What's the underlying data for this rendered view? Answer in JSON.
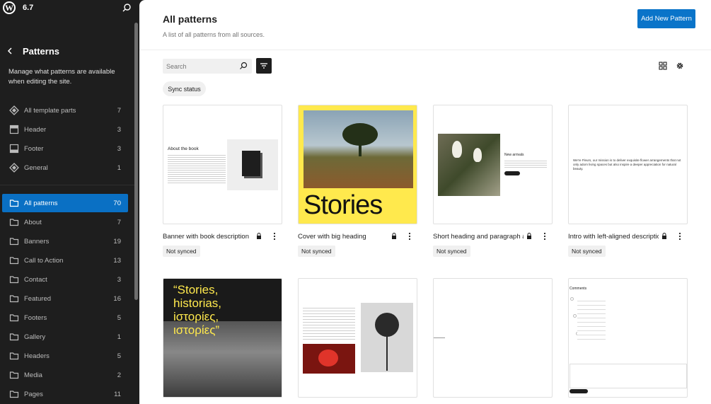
{
  "sidebar": {
    "version": "6.7",
    "title": "Patterns",
    "description": "Manage what patterns are available when editing the site.",
    "parts": [
      {
        "label": "All template parts",
        "count": "7",
        "icon": "diamond-icon"
      },
      {
        "label": "Header",
        "count": "3",
        "icon": "header-icon"
      },
      {
        "label": "Footer",
        "count": "3",
        "icon": "footer-icon"
      },
      {
        "label": "General",
        "count": "1",
        "icon": "diamond-icon"
      }
    ],
    "categories": [
      {
        "label": "All patterns",
        "count": "70"
      },
      {
        "label": "About",
        "count": "7"
      },
      {
        "label": "Banners",
        "count": "19"
      },
      {
        "label": "Call to Action",
        "count": "13"
      },
      {
        "label": "Contact",
        "count": "3"
      },
      {
        "label": "Featured",
        "count": "16"
      },
      {
        "label": "Footers",
        "count": "5"
      },
      {
        "label": "Gallery",
        "count": "1"
      },
      {
        "label": "Headers",
        "count": "5"
      },
      {
        "label": "Media",
        "count": "2"
      },
      {
        "label": "Pages",
        "count": "11"
      }
    ]
  },
  "header": {
    "title": "All patterns",
    "subtitle": "A list of all patterns from all sources.",
    "add_button": "Add New Pattern"
  },
  "toolbar": {
    "search_placeholder": "Search",
    "sync_filter": "Sync status"
  },
  "patterns": [
    {
      "title": "Banner with book description",
      "status": "Not synced"
    },
    {
      "title": "Cover with big heading",
      "status": "Not synced"
    },
    {
      "title": "Short heading and paragraph and image",
      "status": "Not synced"
    },
    {
      "title": "Intro with left-aligned description",
      "status": "Not synced"
    }
  ],
  "previews": {
    "book": {
      "heading": "About the book"
    },
    "cover": {
      "heading": "Stories"
    },
    "short": {
      "heading": "New arrivals"
    },
    "intro": {
      "brand": "Fleurs",
      "text": "We're Fleurs, our mission is to deliver exquisite flower arrangements that not only adorn living spaces but also inspire a deeper appreciation for natural beauty."
    },
    "stories_multi": {
      "heading": "“Stories, historias, iστορίες, ιστορίες”"
    },
    "comments": {
      "heading": "Comments"
    }
  },
  "colors": {
    "accent": "#0a74c9",
    "sidebar_bg": "#1e1e1e",
    "cover_yellow": "#ffe94d"
  }
}
